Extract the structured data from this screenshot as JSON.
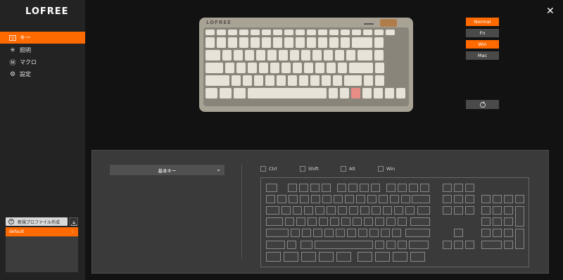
{
  "app": {
    "logo": "LOFREE"
  },
  "sidebar": {
    "items": [
      {
        "label": "キー",
        "icon": "keyboard-icon"
      },
      {
        "label": "照明",
        "icon": "light-icon"
      },
      {
        "label": "マクロ",
        "icon": "macro-icon"
      },
      {
        "label": "設定",
        "icon": "gear-icon"
      }
    ],
    "new_profile_label": "新規プロファイル作成",
    "profiles": [
      {
        "name": "default"
      }
    ]
  },
  "modes": [
    "Normal",
    "Fn",
    "Win",
    "Mac"
  ],
  "keyboard_photo": {
    "brand": "LOFREE"
  },
  "panel": {
    "dropdown_label": "基本キー",
    "modifiers": [
      "Ctrl",
      "Shift",
      "Alt",
      "Win"
    ]
  },
  "colors": {
    "accent": "#ff6a00",
    "sidebar": "#232323",
    "panel": "#3a3a3a"
  }
}
